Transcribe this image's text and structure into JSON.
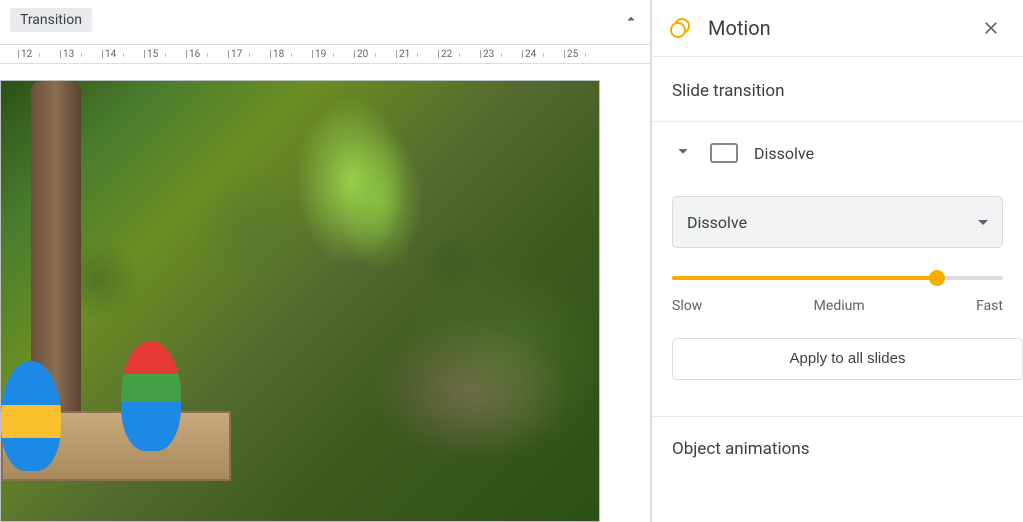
{
  "toolbar": {
    "transition_label": "Transition"
  },
  "ruler": {
    "ticks": [
      12,
      13,
      14,
      15,
      16,
      17,
      18,
      19,
      20,
      21,
      22,
      23,
      24,
      25
    ]
  },
  "motion_panel": {
    "title": "Motion",
    "section_slide_transition": "Slide transition",
    "current_transition_name": "Dissolve",
    "dropdown_value": "Dissolve",
    "speed": {
      "slow_label": "Slow",
      "medium_label": "Medium",
      "fast_label": "Fast",
      "value_percent": 80
    },
    "apply_all_label": "Apply to all slides",
    "section_object_animations": "Object animations"
  }
}
